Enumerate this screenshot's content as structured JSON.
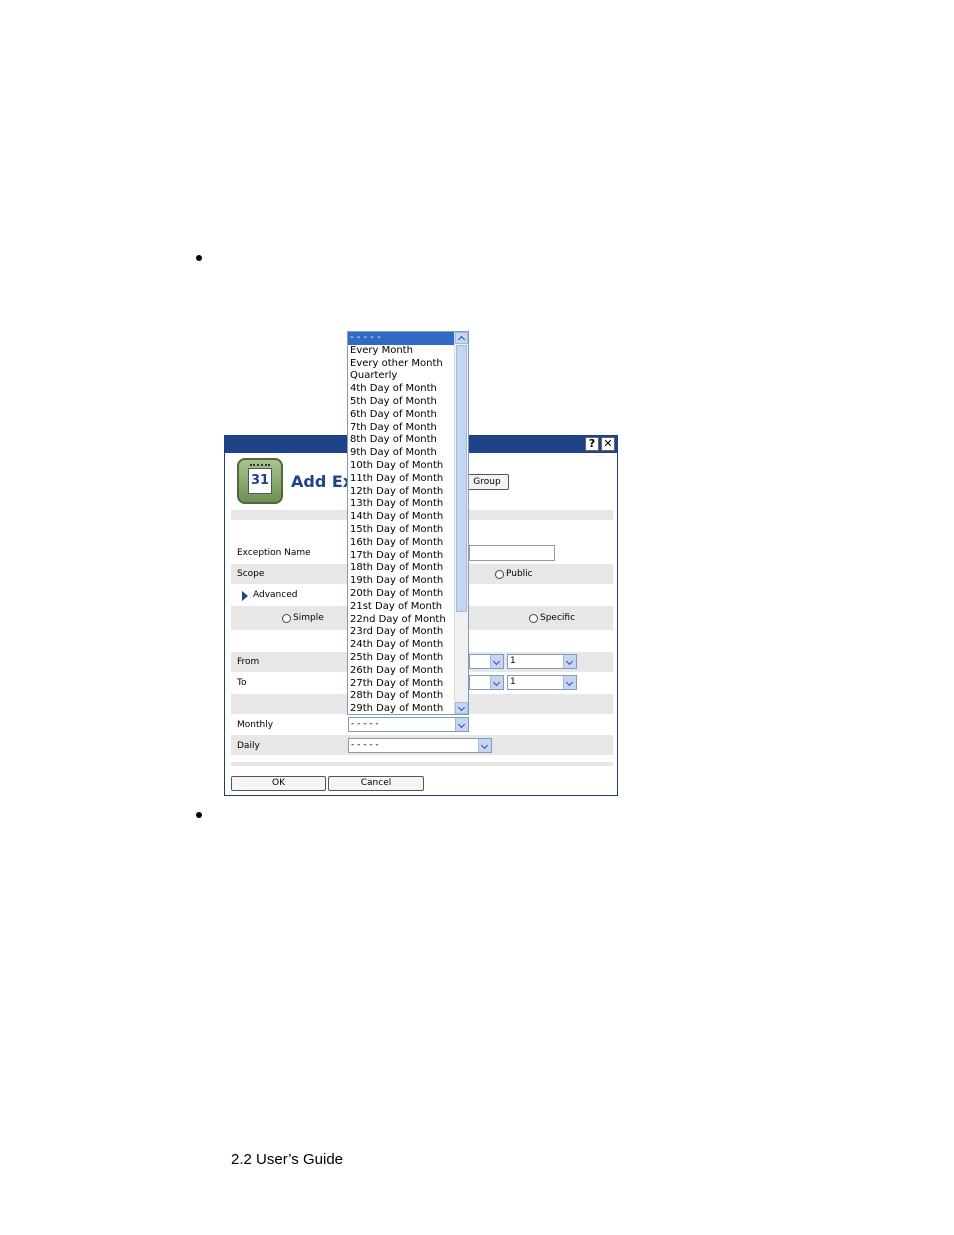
{
  "footer": {
    "text": "2.2 User’s Guide"
  },
  "dialog": {
    "help_symbol": "?",
    "close_symbol": "✕",
    "calendar_number": "31",
    "title": "Add Exc",
    "group_button": "Group",
    "fields": {
      "exception_name": "Exception Name",
      "scope": "Scope",
      "public_radio": "Public",
      "advanced": "Advanced",
      "simple_radio": "Simple",
      "specific_radio": "Specific",
      "from": "From",
      "from_value": "1",
      "to": "To",
      "to_value": "1",
      "monthly": "Monthly",
      "monthly_value": "- - - - -",
      "daily": "Daily",
      "daily_value": "- - - - -"
    },
    "ok_button": "OK",
    "cancel_button": "Cancel"
  },
  "dropdown": {
    "items": [
      "- - - - -",
      "Every Month",
      "Every other Month",
      "Quarterly",
      "4th Day of Month",
      "5th Day of Month",
      "6th Day of Month",
      "7th Day of Month",
      "8th Day of Month",
      "9th Day of Month",
      "10th Day of Month",
      "11th Day of Month",
      "12th Day of Month",
      "13th Day of Month",
      "14th Day of Month",
      "15th Day of Month",
      "16th Day of Month",
      "17th Day of Month",
      "18th Day of Month",
      "19th Day of Month",
      "20th Day of Month",
      "21st Day of Month",
      "22nd Day of Month",
      "23rd Day of Month",
      "24th Day of Month",
      "25th Day of Month",
      "26th Day of Month",
      "27th Day of Month",
      "28th Day of Month",
      "29th Day of Month"
    ],
    "selected_index": 0
  }
}
